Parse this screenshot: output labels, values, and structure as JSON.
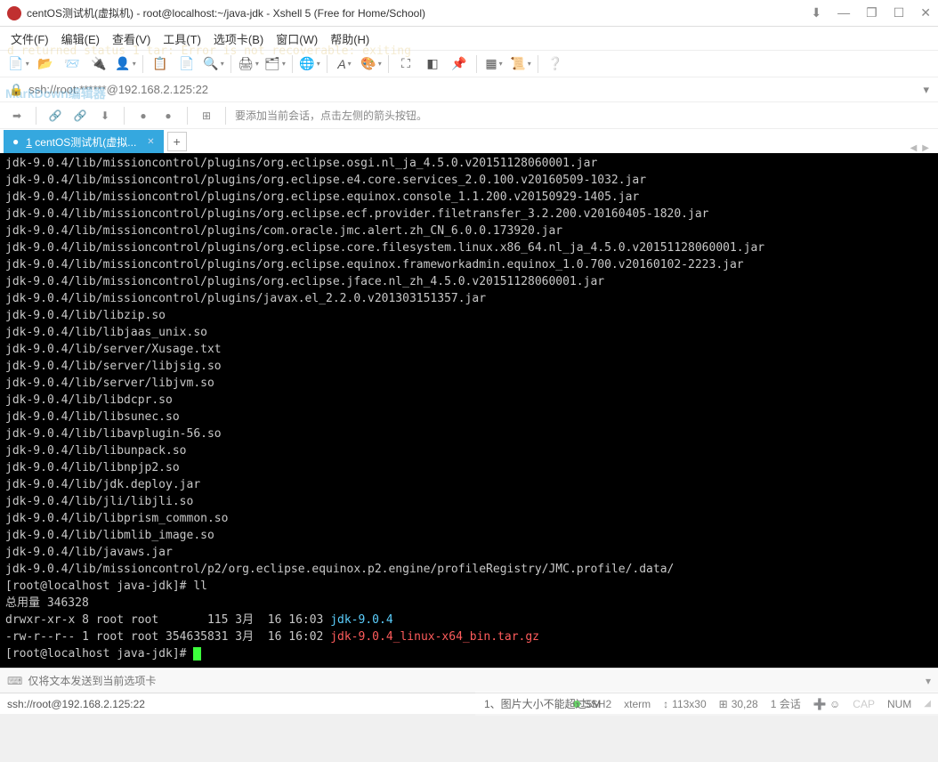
{
  "window": {
    "title": "centOS测试机(虚拟机) - root@localhost:~/java-jdk - Xshell 5 (Free for Home/School)"
  },
  "menu": {
    "file": "文件(F)",
    "edit": "编辑(E)",
    "view": "查看(V)",
    "tools": "工具(T)",
    "tabs": "选项卡(B)",
    "window": "窗口(W)",
    "help": "帮助(H)"
  },
  "ghost1": "d returned status 1 tar: Error is not recoverable: exiting",
  "ghost2": "MarkDown编辑器",
  "address": {
    "text": "ssh://root:******@192.168.2.125:22"
  },
  "session_hint": "要添加当前会话，点击左侧的箭头按钮。",
  "tab": {
    "label": "1 centOS测试机(虚拟...",
    "underline_char": "1"
  },
  "terminal_lines": [
    {
      "t": "jdk-9.0.4/lib/missioncontrol/plugins/org.eclipse.osgi.nl_ja_4.5.0.v20151128060001.jar"
    },
    {
      "t": "jdk-9.0.4/lib/missioncontrol/plugins/org.eclipse.e4.core.services_2.0.100.v20160509-1032.jar"
    },
    {
      "t": "jdk-9.0.4/lib/missioncontrol/plugins/org.eclipse.equinox.console_1.1.200.v20150929-1405.jar"
    },
    {
      "t": "jdk-9.0.4/lib/missioncontrol/plugins/org.eclipse.ecf.provider.filetransfer_3.2.200.v20160405-1820.jar"
    },
    {
      "t": "jdk-9.0.4/lib/missioncontrol/plugins/com.oracle.jmc.alert.zh_CN_6.0.0.173920.jar"
    },
    {
      "t": "jdk-9.0.4/lib/missioncontrol/plugins/org.eclipse.core.filesystem.linux.x86_64.nl_ja_4.5.0.v20151128060001.jar"
    },
    {
      "t": "jdk-9.0.4/lib/missioncontrol/plugins/org.eclipse.equinox.frameworkadmin.equinox_1.0.700.v20160102-2223.jar"
    },
    {
      "t": "jdk-9.0.4/lib/missioncontrol/plugins/org.eclipse.jface.nl_zh_4.5.0.v20151128060001.jar"
    },
    {
      "t": "jdk-9.0.4/lib/missioncontrol/plugins/javax.el_2.2.0.v201303151357.jar"
    },
    {
      "t": "jdk-9.0.4/lib/libzip.so"
    },
    {
      "t": "jdk-9.0.4/lib/libjaas_unix.so"
    },
    {
      "t": "jdk-9.0.4/lib/server/Xusage.txt"
    },
    {
      "t": "jdk-9.0.4/lib/server/libjsig.so"
    },
    {
      "t": "jdk-9.0.4/lib/server/libjvm.so"
    },
    {
      "t": "jdk-9.0.4/lib/libdcpr.so"
    },
    {
      "t": "jdk-9.0.4/lib/libsunec.so"
    },
    {
      "t": "jdk-9.0.4/lib/libavplugin-56.so"
    },
    {
      "t": "jdk-9.0.4/lib/libunpack.so"
    },
    {
      "t": "jdk-9.0.4/lib/libnpjp2.so"
    },
    {
      "t": "jdk-9.0.4/lib/jdk.deploy.jar"
    },
    {
      "t": "jdk-9.0.4/lib/jli/libjli.so"
    },
    {
      "t": "jdk-9.0.4/lib/libprism_common.so"
    },
    {
      "t": "jdk-9.0.4/lib/libmlib_image.so"
    },
    {
      "t": "jdk-9.0.4/lib/javaws.jar"
    },
    {
      "t": "jdk-9.0.4/lib/missioncontrol/p2/org.eclipse.equinox.p2.engine/profileRegistry/JMC.profile/.data/"
    }
  ],
  "prompt1": "[root@localhost java-jdk]# ll",
  "total_line": "总用量 346328",
  "ls_row1_pre": "drwxr-xr-x 8 root root       115 3月  16 16:03 ",
  "ls_row1_name": "jdk-9.0.4",
  "ls_row2_pre": "-rw-r--r-- 1 root root 354635831 3月  16 16:02 ",
  "ls_row2_name": "jdk-9.0.4_linux-x64_bin.tar.gz",
  "prompt2": "[root@localhost java-jdk]# ",
  "inputbar_placeholder": "仅将文本发送到当前选项卡",
  "overlay_text": "1、图片大小不能超过5M",
  "status": {
    "left": "ssh://root@192.168.2.125:22",
    "ssh": "SSH2",
    "term": "xterm",
    "size": "113x30",
    "cursor": "30,28",
    "sessions": "1 会话",
    "cap": "CAP",
    "num": "NUM"
  }
}
